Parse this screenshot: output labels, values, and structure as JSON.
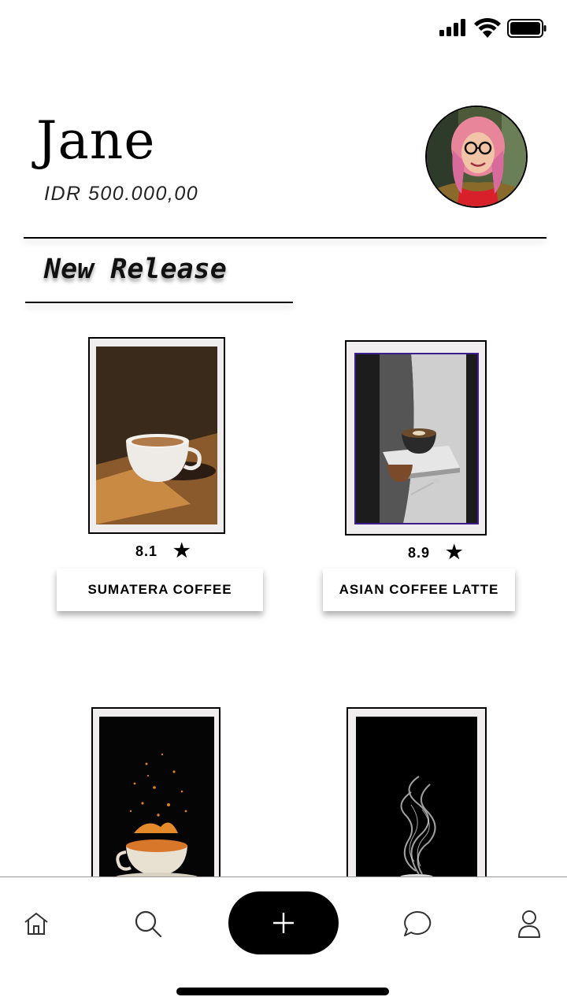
{
  "status_bar": {
    "signal_icon": "cellular-signal-icon",
    "wifi_icon": "wifi-icon",
    "battery_icon": "battery-full-icon"
  },
  "header": {
    "user_name": "Jane",
    "balance": "IDR 500.000,00",
    "avatar": "profile-photo"
  },
  "section": {
    "title": "New Release"
  },
  "products": [
    {
      "name": "SUMATERA COFFEE",
      "rating": "8.1",
      "star_icon": "star-icon",
      "image": "espresso-cup-on-wood"
    },
    {
      "name": "ASIAN COFFEE LATTE",
      "rating": "8.9",
      "star_icon": "star-icon",
      "image": "latte-on-book"
    },
    {
      "name": "",
      "rating": "",
      "image": "coffee-splash-dark"
    },
    {
      "name": "",
      "rating": "",
      "image": "coffee-steam-dark"
    }
  ],
  "bottom_nav": {
    "items": [
      "home-icon",
      "search-icon",
      "plus-icon",
      "chat-icon",
      "user-icon"
    ]
  },
  "colors": {
    "background": "#ffffff",
    "primary": "#000000",
    "card_frame": "#efeded",
    "latte_card_border": "#3a1e8c"
  }
}
